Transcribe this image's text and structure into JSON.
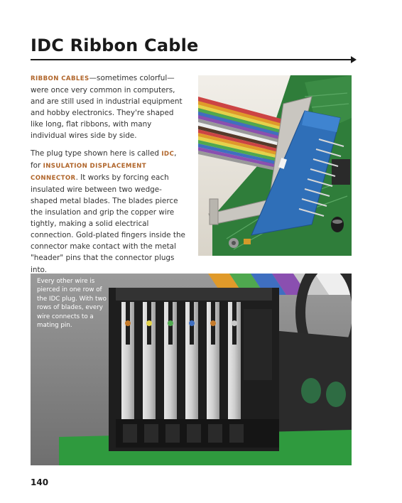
{
  "heading": {
    "title": "IDC Ribbon Cable"
  },
  "body": {
    "p1_kw": "RIBBON CABLES",
    "p1_text": "—sometimes colorful—were once very common in computers, and are still used in industrial equipment and hobby electronics. They're shaped like long, flat ribbons, with many individual wires side by side.",
    "p2_a": "The plug type shown here is called ",
    "p2_kw1": "IDC",
    "p2_b": ", for ",
    "p2_kw2": "INSULATION DISPLACEMENT CONNECTOR",
    "p2_c": ". It works by forcing each insulated wire between two wedge-shaped metal blades. The blades pierce the insulation and grip the copper wire tightly, making a solid electrical connection. Gold-plated fingers inside the connector make contact with the metal \"header\" pins that the connector plugs into."
  },
  "caption": {
    "text": "Every other wire is pierced in one row of the IDC plug. With two rows of blades, every wire connects to a mating pin."
  },
  "footer": {
    "page_number": "140"
  },
  "colors": {
    "title": "#1a1a1a",
    "keyword": "#b0652a",
    "body_text": "#333333",
    "caption_text": "#ffffff",
    "connector_blue": "#2f6fb8",
    "pcb_green": "#2f7d3a",
    "connector_black": "#1e1e1e"
  }
}
